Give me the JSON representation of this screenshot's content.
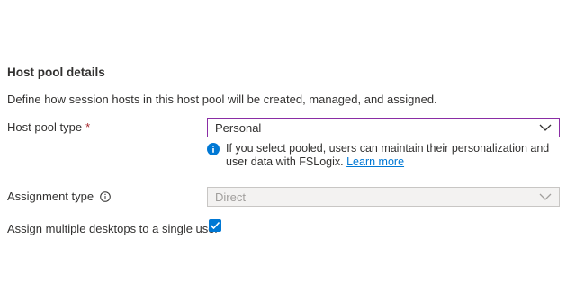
{
  "section": {
    "title": "Host pool details",
    "description": "Define how session hosts in this host pool will be created, managed, and assigned."
  },
  "host_pool_type": {
    "label": "Host pool type",
    "required_mark": "*",
    "selected": "Personal",
    "info_text": "If you select pooled, users can maintain their personalization and user data with FSLogix.",
    "learn_more": "Learn more"
  },
  "assignment_type": {
    "label": "Assignment type",
    "selected": "Direct",
    "disabled": true
  },
  "multiple_desktops": {
    "label": "Assign multiple desktops to a single user",
    "checked": true
  },
  "colors": {
    "accent": "#0078d4",
    "focus_border": "#8a2da5",
    "required": "#a4262c"
  }
}
